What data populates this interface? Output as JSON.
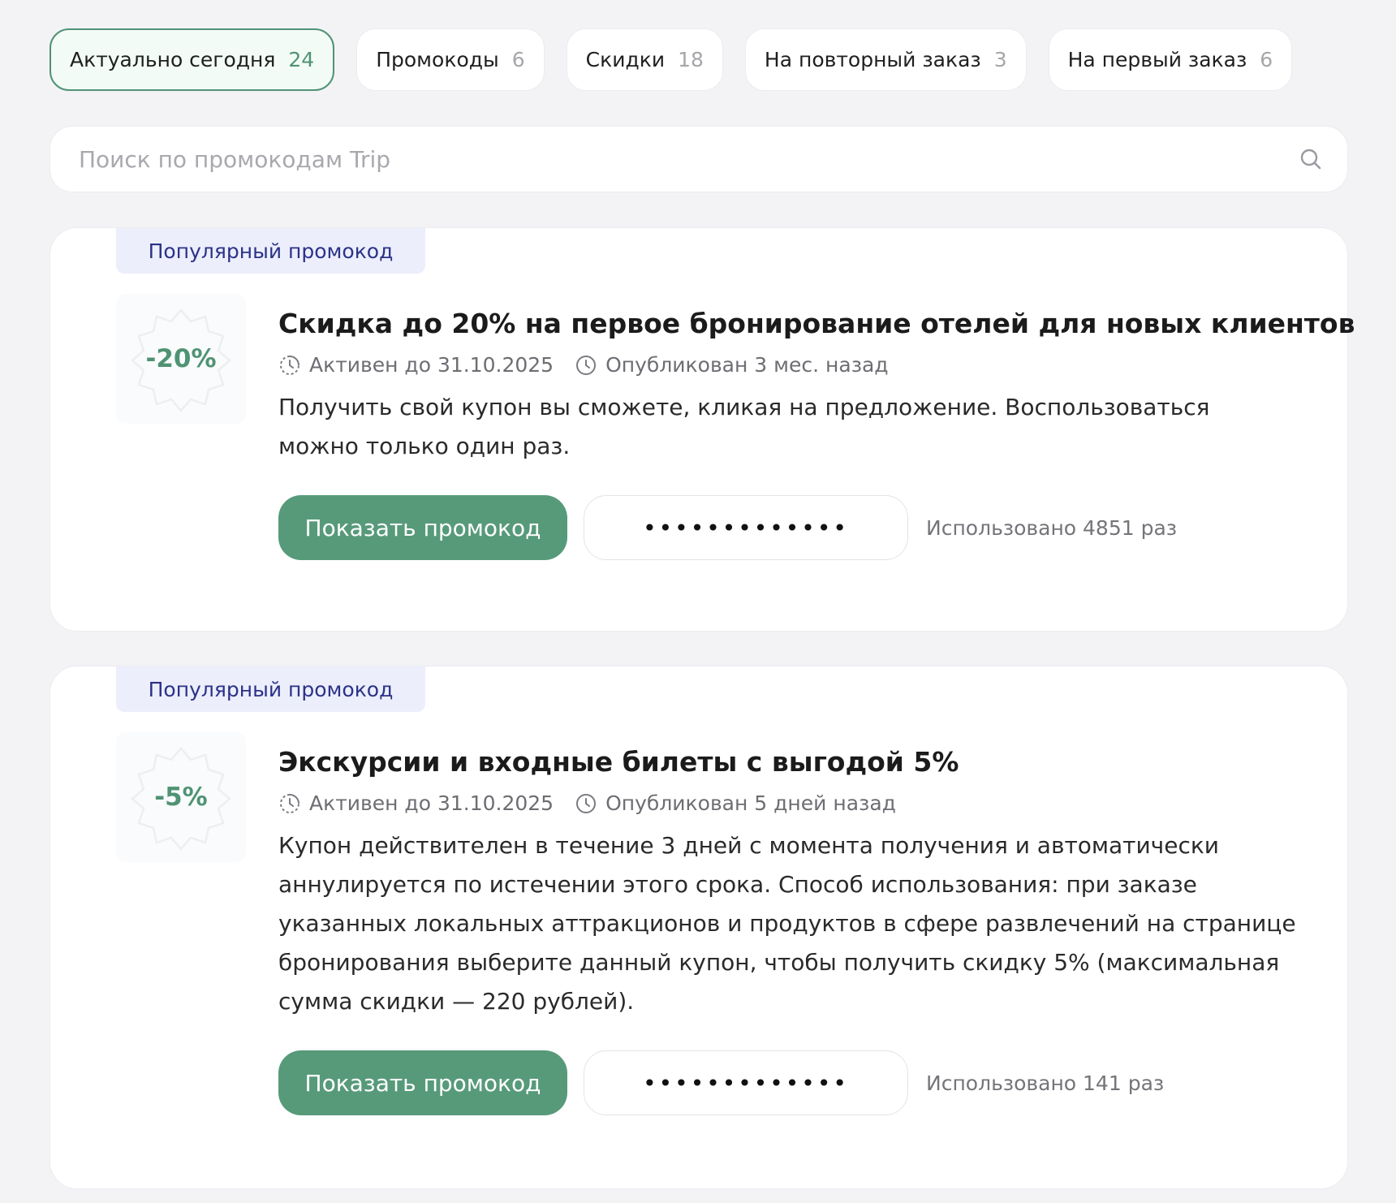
{
  "colors": {
    "accent": "#579a7a",
    "accent_text": "#4f9374",
    "badge_bg": "#eceefb",
    "badge_text": "#2b3288",
    "page_bg": "#f3f3f6"
  },
  "tabs": [
    {
      "label": "Актуально сегодня",
      "count": "24",
      "active": true
    },
    {
      "label": "Промокоды",
      "count": "6",
      "active": false
    },
    {
      "label": "Скидки",
      "count": "18",
      "active": false
    },
    {
      "label": "На повторный заказ",
      "count": "3",
      "active": false
    },
    {
      "label": "На первый заказ",
      "count": "6",
      "active": false
    }
  ],
  "search": {
    "placeholder": "Поиск по промокодам Trip",
    "icon": "search-icon"
  },
  "promos": [
    {
      "badge": "Популярный промокод",
      "discount": "-20%",
      "title": "Скидка до 20% на первое бронирование отелей для новых клиентов",
      "active_until": "Активен до 31.10.2025",
      "published": "Опубликован 3 мес. назад",
      "description_lines": [
        "Получить свой купон вы сможете, кликая на предложение. Воспользоваться",
        "можно только один раз."
      ],
      "button": "Показать промокод",
      "code_mask": "•••••••••••••",
      "used": "Использовано 4851 раз"
    },
    {
      "badge": "Популярный промокод",
      "discount": "-5%",
      "title": "Экскурсии и входные билеты с выгодой 5%",
      "active_until": "Активен до 31.10.2025",
      "published": "Опубликован 5 дней назад",
      "description_lines": [
        "Купон действителен в течение 3 дней с момента получения и автоматически",
        "аннулируется по истечении этого срока. Способ использования: при заказе",
        "указанных локальных аттракционов и продуктов в сфере развлечений на странице",
        "бронирования выберите данный купон, чтобы получить скидку 5% (максимальная",
        "сумма скидки — 220 рублей)."
      ],
      "button": "Показать промокод",
      "code_mask": "•••••••••••••",
      "used": "Использовано 141 раз"
    }
  ]
}
